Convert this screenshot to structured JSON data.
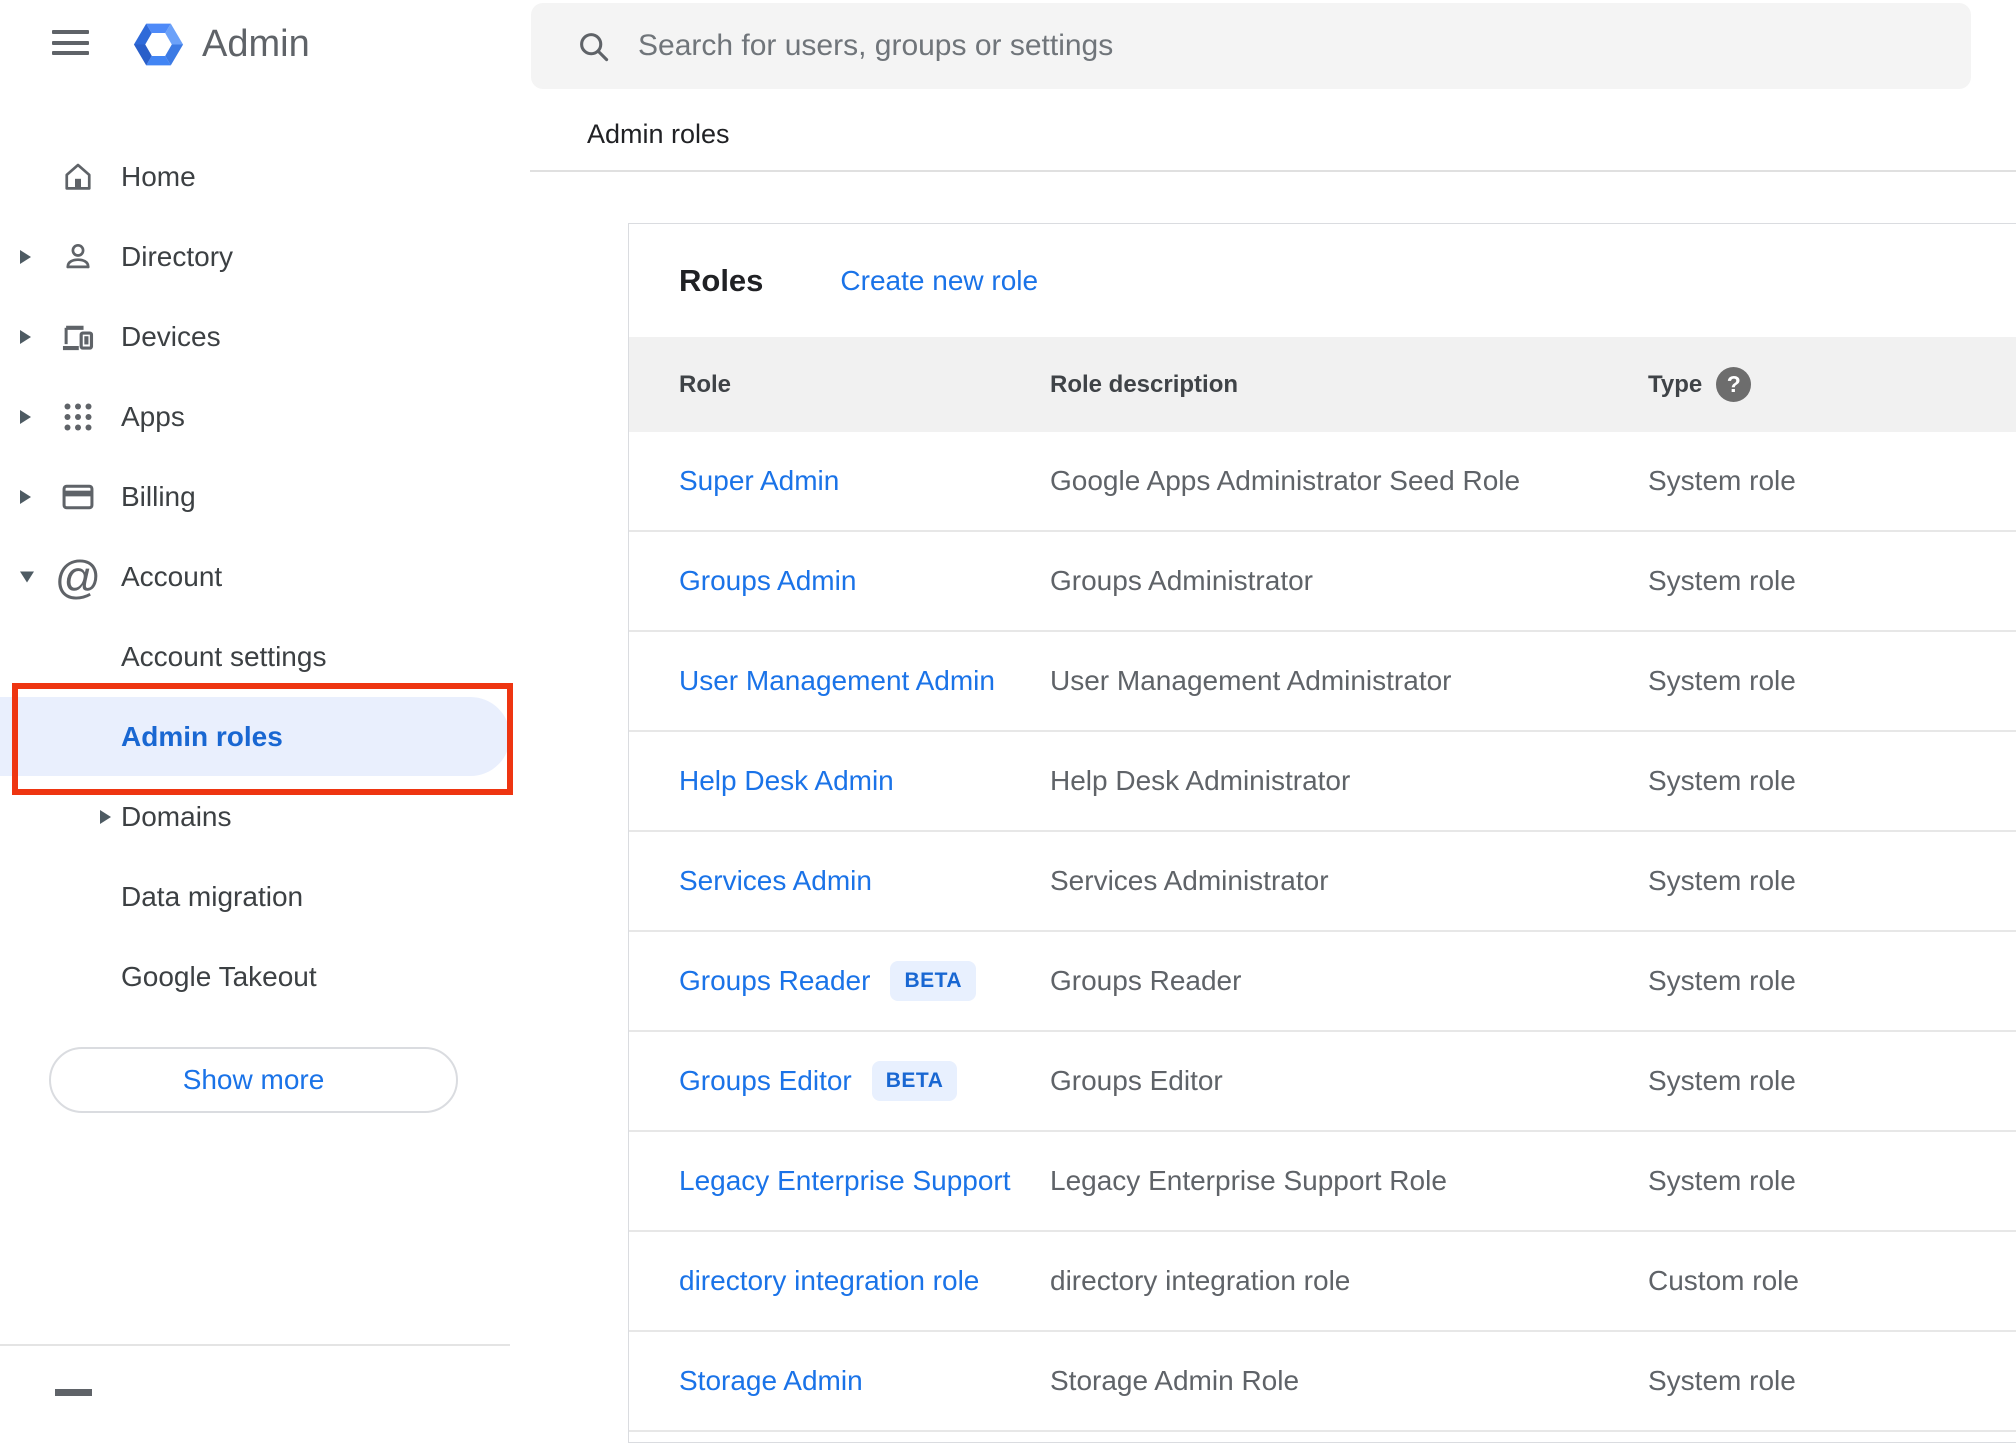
{
  "app": {
    "name": "Admin"
  },
  "search": {
    "placeholder": "Search for users, groups or settings"
  },
  "breadcrumb": "Admin roles",
  "sidebar": {
    "items": [
      {
        "label": "Home",
        "icon": "home",
        "expandable": false
      },
      {
        "label": "Directory",
        "icon": "person",
        "expandable": true
      },
      {
        "label": "Devices",
        "icon": "devices",
        "expandable": true
      },
      {
        "label": "Apps",
        "icon": "apps-grid",
        "expandable": true
      },
      {
        "label": "Billing",
        "icon": "credit-card",
        "expandable": true
      },
      {
        "label": "Account",
        "icon": "at-sign",
        "expandable": true,
        "expanded": true
      }
    ],
    "account_sub_items": [
      {
        "label": "Account settings"
      },
      {
        "label": "Admin roles",
        "selected": true,
        "annotated": true
      },
      {
        "label": "Domains",
        "expandable": true
      },
      {
        "label": "Data migration"
      },
      {
        "label": "Google Takeout"
      }
    ],
    "show_more_label": "Show more"
  },
  "roles_panel": {
    "title": "Roles",
    "create_link": "Create new role",
    "columns": {
      "role": "Role",
      "description": "Role description",
      "type": "Type"
    },
    "rows": [
      {
        "role": "Super Admin",
        "description": "Google Apps Administrator Seed Role",
        "type": "System role"
      },
      {
        "role": "Groups Admin",
        "description": "Groups Administrator",
        "type": "System role"
      },
      {
        "role": "User Management Admin",
        "description": "User Management Administrator",
        "type": "System role"
      },
      {
        "role": "Help Desk Admin",
        "description": "Help Desk Administrator",
        "type": "System role"
      },
      {
        "role": "Services Admin",
        "description": "Services Administrator",
        "type": "System role"
      },
      {
        "role": "Groups Reader",
        "badge": "BETA",
        "description": "Groups Reader",
        "type": "System role"
      },
      {
        "role": "Groups Editor",
        "badge": "BETA",
        "description": "Groups Editor",
        "type": "System role"
      },
      {
        "role": "Legacy Enterprise Support",
        "description": "Legacy Enterprise Support Role",
        "type": "System role"
      },
      {
        "role": "directory integration role",
        "description": "directory integration role",
        "type": "Custom role"
      },
      {
        "role": "Storage Admin",
        "description": "Storage Admin Role",
        "type": "System role"
      }
    ]
  },
  "accent_colors": {
    "link_blue": "#1a73e8",
    "selected_item_blue": "#1967d2",
    "selected_pill_bg": "#e9effd",
    "annotation_red": "#ee3511",
    "beta_badge_bg": "#e8f0fe",
    "logo_blue": "#4285f4"
  }
}
